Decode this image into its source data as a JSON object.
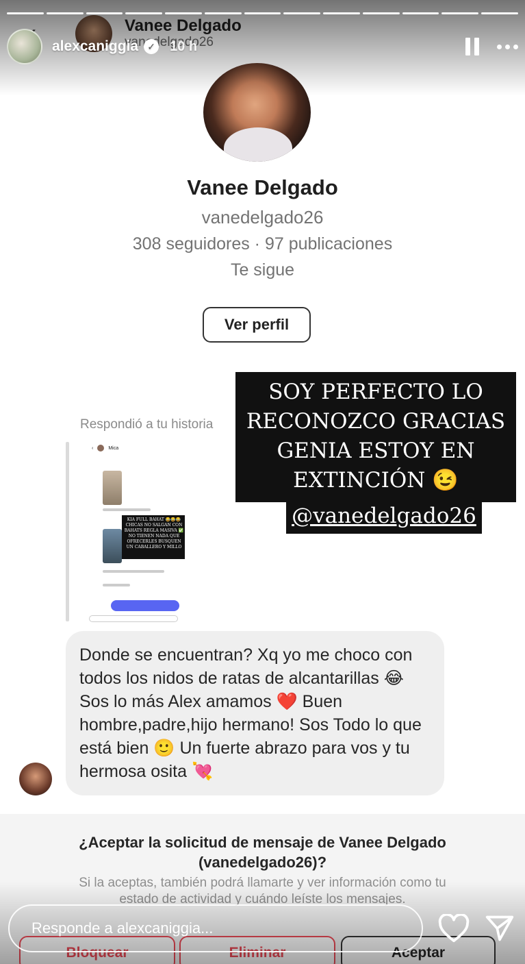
{
  "story": {
    "username": "alexcaniggia",
    "time": "10 h",
    "reply_placeholder": "Responde a alexcaniggia..."
  },
  "dm_header": {
    "name": "Vanee Delgado",
    "handle": "vanedelgado26"
  },
  "profile": {
    "name": "Vanee Delgado",
    "handle": "vanedelgado26",
    "stats": "308 seguidores · 97 publicaciones",
    "follows": "Te sigue",
    "view_button": "Ver perfil"
  },
  "overlay": {
    "text": "SOY PERFECTO LO RECONOZCO GRACIAS GENIA ESTOY EN EXTINCIÓN 😉",
    "mention": "@vanedelgado26"
  },
  "reply": {
    "label": "Respondió a tu historia",
    "thumb_overlay": "KIA FULL BAHAT 😂😂😂 CHICAS NO SALGAN CON BAHATS REGLA MASIVA ✅ NO TIENEN NADA QUE OFRECERLES BUSQUEN UN CABALLERO Y MILLO"
  },
  "message": {
    "text": "Donde se encuentran? Xq yo me choco con todos los nidos de ratas de alcantarillas 😂 Sos lo más Alex amamos ❤️ Buen hombre,padre,hijo hermano! Sos Todo lo que está bien 🙂 Un fuerte abrazo para vos y tu hermosa osita 💘"
  },
  "request": {
    "title_line1": "¿Aceptar la solicitud de mensaje de Vanee Delgado",
    "title_line2": "(vanedelgado26)?",
    "subtitle_line1": "Si la aceptas, también podrá llamarte y ver información como tu",
    "subtitle_line2": "estado de actividad y cuándo leíste los mensajes.",
    "block": "Bloquear",
    "delete": "Eliminar",
    "accept": "Aceptar"
  },
  "colors": {
    "danger": "#ed4956",
    "bubble": "#efefef",
    "muted": "#737373"
  }
}
